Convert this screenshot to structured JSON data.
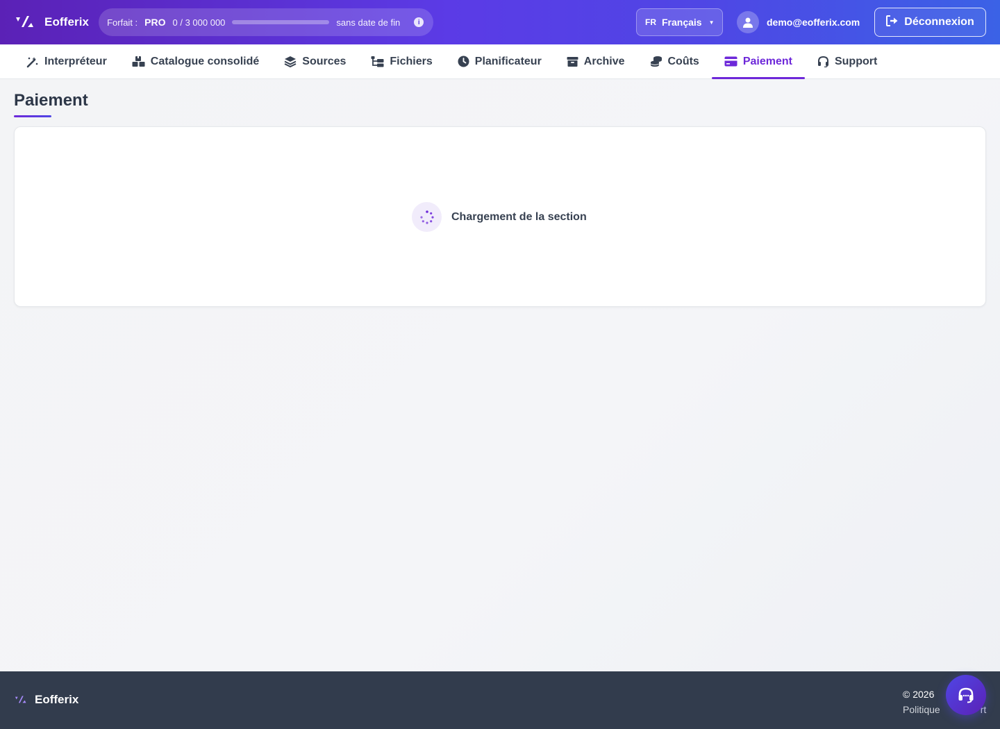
{
  "header": {
    "brand": "Eofferix",
    "plan": {
      "label": "Forfait :",
      "name": "PRO",
      "usage": "0  /  3 000 000",
      "usage_fraction": 0,
      "end_label": "sans date de fin"
    },
    "language": {
      "code": "FR",
      "label": "Français"
    },
    "user_email": "demo@eofferix.com",
    "logout_label": "Déconnexion"
  },
  "nav": {
    "tabs": [
      {
        "label": "Interpréteur",
        "icon": "magic-wand-icon"
      },
      {
        "label": "Catalogue consolidé",
        "icon": "boxes-icon"
      },
      {
        "label": "Sources",
        "icon": "layers-icon"
      },
      {
        "label": "Fichiers",
        "icon": "folder-tree-icon"
      },
      {
        "label": "Planificateur",
        "icon": "clock-icon"
      },
      {
        "label": "Archive",
        "icon": "archive-box-icon"
      },
      {
        "label": "Coûts",
        "icon": "coins-icon"
      },
      {
        "label": "Paiement",
        "icon": "credit-card-icon",
        "active": true
      },
      {
        "label": "Support",
        "icon": "headset-icon"
      }
    ]
  },
  "main": {
    "title": "Paiement",
    "loading_text": "Chargement de la section"
  },
  "footer": {
    "brand": "Eofferix",
    "copyright": "© 2026",
    "links": "Politique",
    "links_tail": "rt"
  },
  "colors": {
    "accent": "#6d28d9",
    "header_gradient_start": "#5b21b6",
    "header_gradient_end": "#3b62e6",
    "footer_bg": "#323c4d"
  }
}
